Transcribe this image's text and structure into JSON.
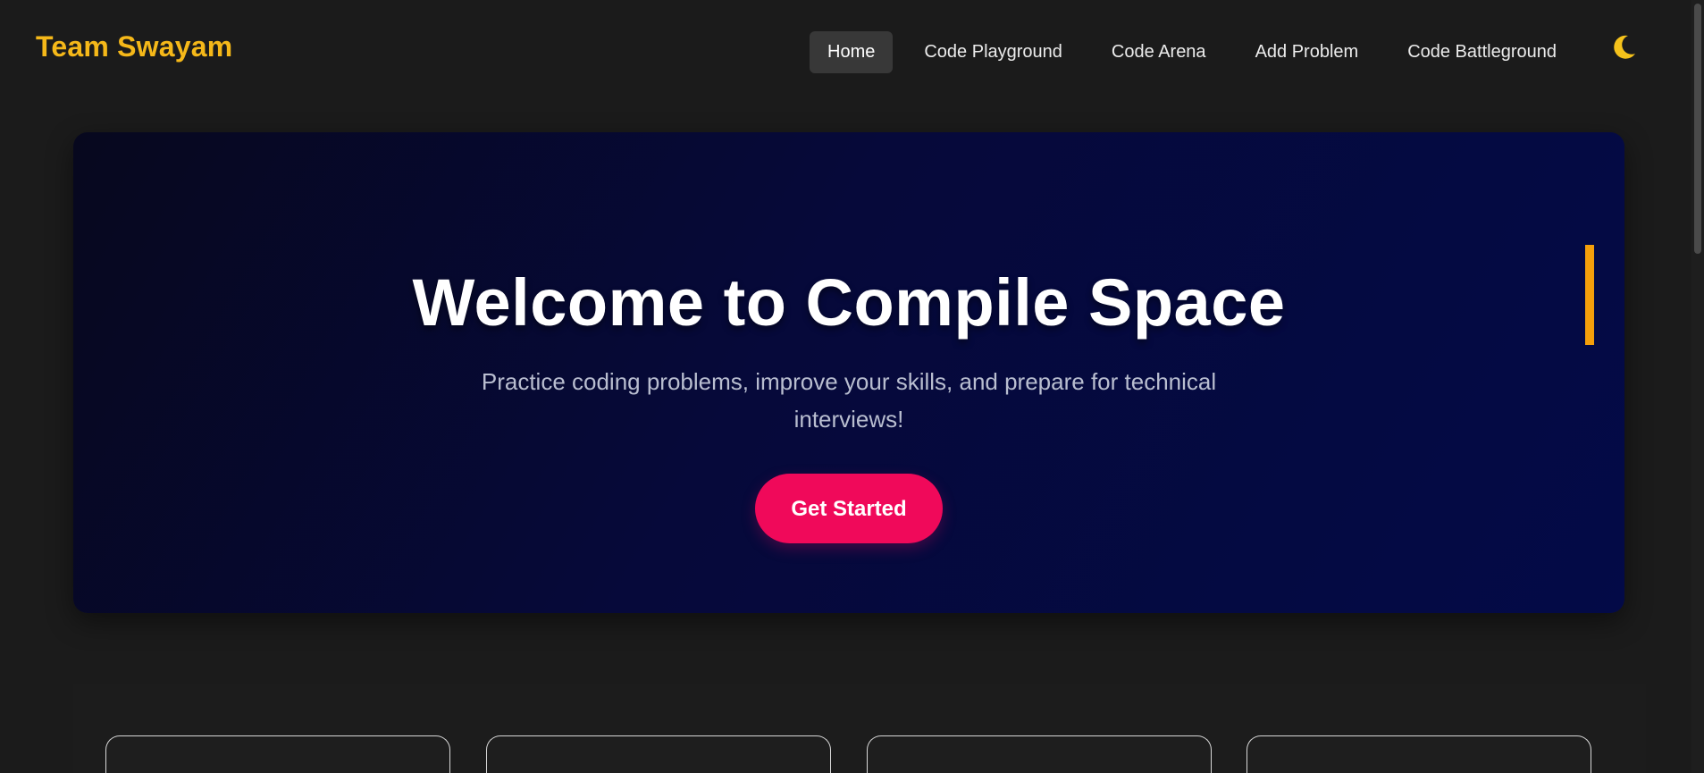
{
  "header": {
    "brand": "Team Swayam",
    "nav": [
      {
        "label": "Home",
        "active": true
      },
      {
        "label": "Code Playground",
        "active": false
      },
      {
        "label": "Code Arena",
        "active": false
      },
      {
        "label": "Add Problem",
        "active": false
      },
      {
        "label": "Code Battleground",
        "active": false
      }
    ],
    "theme_toggle_icon": "moon-icon"
  },
  "hero": {
    "title": "Welcome to Compile Space",
    "subtitle": "Practice coding problems, improve your skills, and prepare for technical interviews!",
    "cta_label": "Get Started"
  },
  "colors": {
    "brand": "#f5b819",
    "cta": "#f0095a",
    "accent": "#f59f0a",
    "background": "#1b1b1b",
    "hero_gradient_start": "#07081e",
    "hero_gradient_end": "#030a47"
  }
}
